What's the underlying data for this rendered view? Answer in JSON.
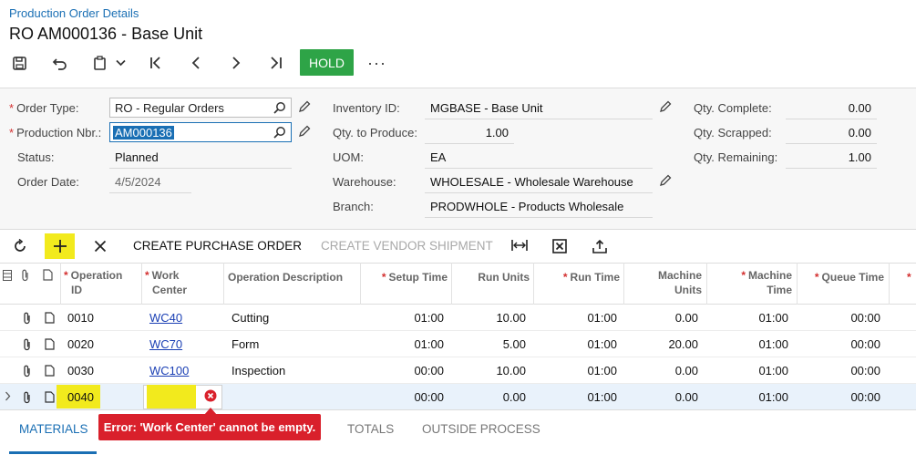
{
  "header": {
    "breadcrumb": "Production Order Details",
    "title": "RO AM000136 - Base Unit",
    "hold_label": "HOLD",
    "more_label": "···"
  },
  "form": {
    "order_type_label": "Order Type:",
    "order_type_value": "RO - Regular Orders",
    "production_nbr_label": "Production Nbr.:",
    "production_nbr_value": "AM000136",
    "status_label": "Status:",
    "status_value": "Planned",
    "order_date_label": "Order Date:",
    "order_date_value": "4/5/2024",
    "inventory_id_label": "Inventory ID:",
    "inventory_id_value": "MGBASE - Base Unit",
    "qty_to_produce_label": "Qty. to Produce:",
    "qty_to_produce_value": "1.00",
    "uom_label": "UOM:",
    "uom_value": "EA",
    "warehouse_label": "Warehouse:",
    "warehouse_value": "WHOLESALE - Wholesale Warehouse",
    "branch_label": "Branch:",
    "branch_value": "PRODWHOLE - Products Wholesale",
    "qty_complete_label": "Qty. Complete:",
    "qty_complete_value": "0.00",
    "qty_scrapped_label": "Qty. Scrapped:",
    "qty_scrapped_value": "0.00",
    "qty_remaining_label": "Qty. Remaining:",
    "qty_remaining_value": "1.00"
  },
  "grid_toolbar": {
    "create_po_label": "CREATE PURCHASE ORDER",
    "create_vendor_shipment_label": "CREATE VENDOR SHIPMENT"
  },
  "grid": {
    "headers": {
      "operation_id_1": "Operation",
      "operation_id_2": "ID",
      "work_center_1": "Work",
      "work_center_2": "Center",
      "operation_description": "Operation Description",
      "setup_time": "Setup Time",
      "run_units": "Run Units",
      "run_time": "Run Time",
      "machine_units_1": "Machine",
      "machine_units_2": "Units",
      "machine_time_1": "Machine",
      "machine_time_2": "Time",
      "queue_time": "Queue Time"
    },
    "rows": [
      {
        "operation_id": "0010",
        "work_center": "WC40",
        "description": "Cutting",
        "setup_time": "01:00",
        "run_units": "10.00",
        "run_time": "01:00",
        "machine_units": "0.00",
        "machine_time": "01:00",
        "queue_time": "00:00"
      },
      {
        "operation_id": "0020",
        "work_center": "WC70",
        "description": "Form",
        "setup_time": "01:00",
        "run_units": "5.00",
        "run_time": "01:00",
        "machine_units": "20.00",
        "machine_time": "01:00",
        "queue_time": "00:00"
      },
      {
        "operation_id": "0030",
        "work_center": "WC100",
        "description": "Inspection",
        "setup_time": "00:00",
        "run_units": "10.00",
        "run_time": "01:00",
        "machine_units": "0.00",
        "machine_time": "01:00",
        "queue_time": "00:00"
      },
      {
        "operation_id": "0040",
        "work_center": "",
        "description": "",
        "setup_time": "00:00",
        "run_units": "0.00",
        "run_time": "01:00",
        "machine_units": "0.00",
        "machine_time": "01:00",
        "queue_time": "00:00"
      }
    ]
  },
  "tabs": {
    "materials": "MATERIALS",
    "totals": "TOTALS",
    "outside_process": "OUTSIDE PROCESS"
  },
  "error": {
    "message": "Error: 'Work Center' cannot be empty."
  },
  "colors": {
    "hold_green": "#2ea447",
    "highlight_yellow": "#f2ea1d",
    "error_red": "#d9202b",
    "link_blue": "#1a6fb4"
  }
}
